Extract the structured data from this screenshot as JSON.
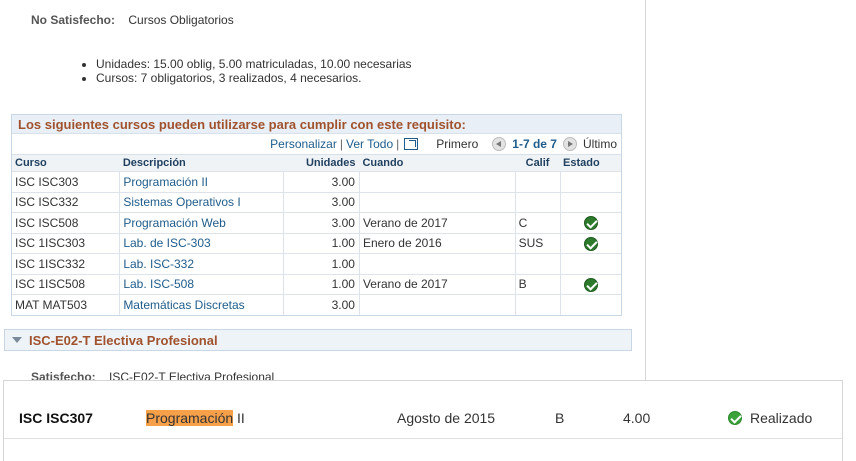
{
  "status": {
    "label": "No Satisfecho:",
    "value": "Cursos Obligatorios"
  },
  "bullets": [
    "Unidades: 15.00 oblig, 5.00 matriculadas, 10.00 necesarias",
    "Cursos: 7 obligatorios, 3 realizados, 4 necesarios."
  ],
  "grid": {
    "title": "Los siguientes cursos pueden utilizarse para cumplir con este requisito:",
    "nav": {
      "personalize": "Personalizar",
      "separator": "|",
      "view_all": "Ver Todo",
      "first": "Primero",
      "count": "1-7 de 7",
      "last": "Último"
    },
    "headers": [
      "Curso",
      "Descripción",
      "Unidades",
      "Cuando",
      "Calif",
      "Estado"
    ],
    "rows": [
      {
        "course": "ISC ISC303",
        "desc": "Programación II",
        "units": "3.00",
        "when": "",
        "grade": "",
        "done": false
      },
      {
        "course": "ISC ISC332",
        "desc": "Sistemas Operativos I",
        "units": "3.00",
        "when": "",
        "grade": "",
        "done": false
      },
      {
        "course": "ISC ISC508",
        "desc": "Programación Web",
        "units": "3.00",
        "when": "Verano de 2017",
        "grade": "C",
        "done": true
      },
      {
        "course": "ISC 1ISC303",
        "desc": "Lab. de ISC-303",
        "units": "1.00",
        "when": "Enero de 2016",
        "grade": "SUS",
        "done": true
      },
      {
        "course": "ISC 1ISC332",
        "desc": "Lab. ISC-332",
        "units": "1.00",
        "when": "",
        "grade": "",
        "done": false
      },
      {
        "course": "ISC 1ISC508",
        "desc": "Lab. ISC-508",
        "units": "1.00",
        "when": "Verano de 2017",
        "grade": "B",
        "done": true
      },
      {
        "course": "MAT MAT503",
        "desc": "Matemáticas Discretas",
        "units": "3.00",
        "when": "",
        "grade": "",
        "done": false
      }
    ]
  },
  "section": {
    "title": "ISC-E02-T Electiva Profesional"
  },
  "section_status": {
    "label": "Satisfecho:",
    "value": "ISC-E02-T Electiva Profesional"
  },
  "result": {
    "code": "ISC ISC307",
    "name_highlight": "Programación",
    "name_rest": " II",
    "date": "Agosto de 2015",
    "grade": "B",
    "units": "4.00",
    "status": "Realizado"
  },
  "colors": {
    "accent_title": "#a0522d",
    "link": "#1f5c8b",
    "check": "#2d7a2d",
    "highlight": "#f7a04a"
  }
}
